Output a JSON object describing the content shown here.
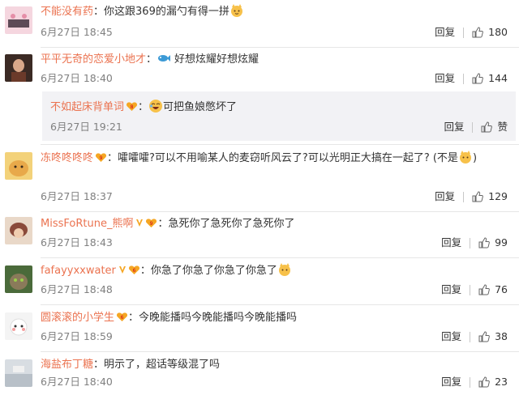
{
  "comments": [
    {
      "user": "不能没有药",
      "text": "你这跟369的漏勺有得一拼",
      "time": "6月27日 18:45",
      "reply_label": "回复",
      "likes": "180"
    },
    {
      "user": "平平无奇的恋爱小地才",
      "text": "好想炫耀好想炫耀",
      "time": "6月27日 18:40",
      "reply_label": "回复",
      "likes": "144"
    },
    {
      "user": "冻咚咚咚咚",
      "text": "嚯嚯嚯?可以不用喻某人的麦窃听风云了?可以光明正大搞在一起了? (不是",
      "text_end": ")",
      "time": "6月27日 18:37",
      "reply_label": "回复",
      "likes": "129"
    },
    {
      "user": "MissFoRtune_熊啊",
      "text": "急死你了急死你了急死你了",
      "time": "6月27日 18:43",
      "reply_label": "回复",
      "likes": "99"
    },
    {
      "user": "fafayyxxwater",
      "text": "你急了你急了你急了你急了",
      "time": "6月27日 18:48",
      "reply_label": "回复",
      "likes": "76"
    },
    {
      "user": "圆滚滚的小学生",
      "text": "今晚能播吗今晚能播吗今晚能播吗",
      "time": "6月27日 18:59",
      "reply_label": "回复",
      "likes": "38"
    },
    {
      "user": "海盐布丁糖",
      "text": "明示了，超话等级混了吗",
      "time": "6月27日 18:40",
      "reply_label": "回复",
      "likes": "23"
    }
  ],
  "nested_reply": {
    "user": "不如起床背单词",
    "text": "可把鱼娘憋坏了",
    "time": "6月27日 19:21",
    "reply_label": "回复",
    "likes": "赞"
  },
  "colors": {
    "username": "#eb7350",
    "time": "#808080",
    "reply_bg": "#f2f2f5"
  },
  "icons": [
    "cat-face-emoji",
    "fish-emoji",
    "laughing-emoji",
    "fan-badge-icon",
    "v-badge-icon",
    "thumbs-up-icon"
  ]
}
